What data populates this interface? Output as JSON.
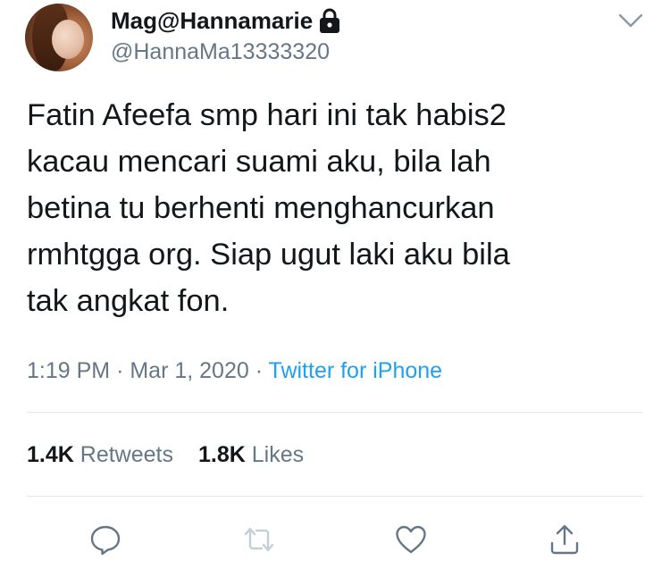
{
  "user": {
    "display_name": "Mag@Hannamarie",
    "handle": "@HannaMa13333320",
    "protected_icon": "lock-icon",
    "avatar": "avatar"
  },
  "menu": {
    "icon": "chevron-down-icon"
  },
  "tweet": {
    "text": "Fatin Afeefa smp hari ini tak habis2\nkacau mencari suami aku, bila lah\nbetina tu berhenti menghancurkan\nrmhtgga org. Siap ugut laki aku bila\ntak angkat fon.",
    "time": "1:19 PM",
    "date": "Mar 1, 2020",
    "separator": "·",
    "source": "Twitter for iPhone"
  },
  "stats": {
    "retweets_count": "1.4K",
    "retweets_label": "Retweets",
    "likes_count": "1.8K",
    "likes_label": "Likes"
  },
  "actions": {
    "reply_icon": "reply-icon",
    "retweet_icon": "retweet-icon",
    "like_icon": "heart-icon",
    "share_icon": "share-icon"
  },
  "colors": {
    "text": "#14171a",
    "secondary": "#657786",
    "link": "#1da1f2",
    "divider": "#e1e8ed",
    "retweet_disabled": "#c4cfd6"
  }
}
